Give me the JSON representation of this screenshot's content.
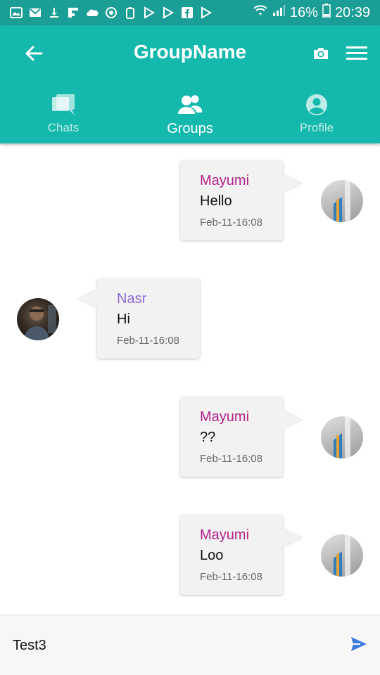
{
  "status_bar": {
    "battery_percent": "16%",
    "time": "20:39",
    "notification_icons": [
      "image-icon",
      "gmail-icon",
      "download-icon",
      "flipboard-icon",
      "cloud-icon",
      "sync-icon",
      "clipboard-icon",
      "play-store-icon",
      "play-store-icon",
      "facebook-icon",
      "play-store-icon"
    ]
  },
  "header": {
    "title": "GroupName"
  },
  "tabs": [
    {
      "label": "Chats",
      "icon": "chat-icon",
      "active": false
    },
    {
      "label": "Groups",
      "icon": "groups-icon",
      "active": true
    },
    {
      "label": "Profile",
      "icon": "profile-icon",
      "active": false
    }
  ],
  "messages": [
    {
      "sender": "Mayumi",
      "text": "Hello",
      "time": "Feb-11-16:08",
      "side": "right"
    },
    {
      "sender": "Nasr",
      "text": "Hi",
      "time": "Feb-11-16:08",
      "side": "left"
    },
    {
      "sender": "Mayumi",
      "text": "??",
      "time": "Feb-11-16:08",
      "side": "right"
    },
    {
      "sender": "Mayumi",
      "text": "Loo",
      "time": "Feb-11-16:08",
      "side": "right"
    }
  ],
  "composer": {
    "value": "Test3"
  },
  "colors": {
    "status_bar": "#1a9e96",
    "app_bar": "#14b8ad",
    "mayumi_name": "#b3218a",
    "nasr_name": "#8e6bd6",
    "send": "#3d7be0"
  }
}
